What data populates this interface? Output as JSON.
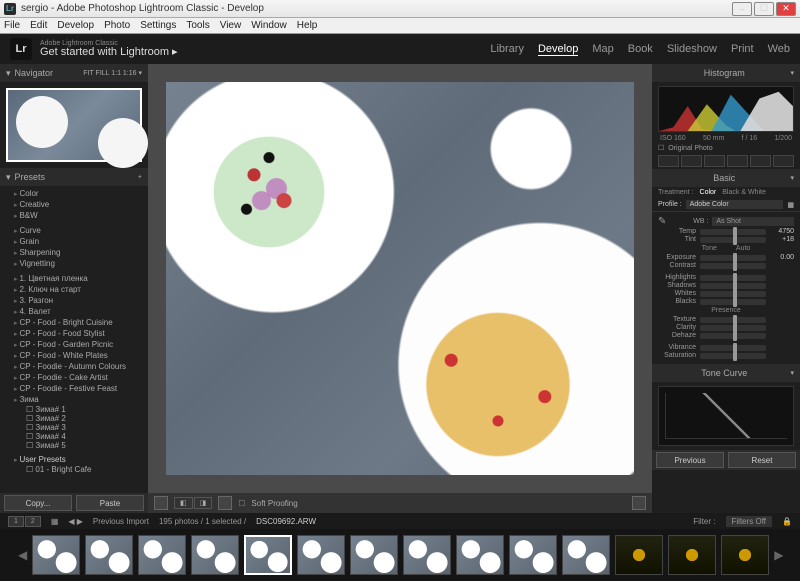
{
  "window": {
    "title": "sergio - Adobe Photoshop Lightroom Classic - Develop"
  },
  "menu": [
    "File",
    "Edit",
    "Develop",
    "Photo",
    "Settings",
    "Tools",
    "View",
    "Window",
    "Help"
  ],
  "brand": {
    "sub": "Adobe Lightroom Classic",
    "main": "Get started with Lightroom ▸"
  },
  "modules": [
    "Library",
    "Develop",
    "Map",
    "Book",
    "Slideshow",
    "Print",
    "Web"
  ],
  "active_module": "Develop",
  "navigator": {
    "title": "Navigator",
    "modes": "FIT   FILL   1:1   1:16 ▾"
  },
  "presets": {
    "title": "Presets",
    "groups": [
      "Color",
      "Creative",
      "B&W",
      "",
      "Curve",
      "Grain",
      "Sharpening",
      "Vignetting",
      "",
      "1. Цветная пленка",
      "2. Ключ на старт",
      "3. Разгон",
      "4. Валет",
      "CP - Food - Bright Cuisine",
      "CP - Food - Food Stylist",
      "CP - Food - Garden Picnic",
      "CP - Food - White Plates",
      "CP - Foodie - Autumn Colours",
      "CP - Foodie - Cake Artist",
      "CP - Foodie - Festive Feast",
      "Зима"
    ],
    "subs": [
      "Зима# 1",
      "Зима# 2",
      "Зима# 3",
      "Зима# 4",
      "Зима# 5"
    ],
    "user_head": "User Presets",
    "user_item": "01 - Bright Cafe"
  },
  "left_foot": {
    "copy": "Copy...",
    "paste": "Paste"
  },
  "toolbar": {
    "soft": "Soft Proofing"
  },
  "histogram": {
    "title": "Histogram",
    "iso": "ISO 160",
    "focal": "50 mm",
    "f": "f / 16",
    "shutter": "1/200",
    "orig": "Original Photo"
  },
  "basic": {
    "title": "Basic",
    "treat_lbl": "Treatment :",
    "color": "Color",
    "bw": "Black & White",
    "profile_lbl": "Profile :",
    "profile": "Adobe Color",
    "wb_lbl": "WB :",
    "wb": "As Shot",
    "temp": "Temp",
    "temp_v": "4750",
    "tint": "Tint",
    "tint_v": "+18",
    "tone": "Tone",
    "auto": "Auto",
    "exposure": "Exposure",
    "exposure_v": "0.00",
    "contrast": "Contrast",
    "highlights": "Highlights",
    "shadows": "Shadows",
    "whites": "Whites",
    "blacks": "Blacks",
    "presence": "Presence",
    "texture": "Texture",
    "clarity": "Clarity",
    "dehaze": "Dehaze",
    "vibrance": "Vibrance",
    "saturation": "Saturation"
  },
  "tone_curve": "Tone Curve",
  "right_foot": {
    "prev": "Previous",
    "reset": "Reset"
  },
  "filmstrip_bar": {
    "nav": "Previous Import",
    "count": "195 photos / 1 selected /",
    "file": "DSC09692.ARW",
    "filter_lbl": "Filter :",
    "filter": "Filters Off"
  }
}
